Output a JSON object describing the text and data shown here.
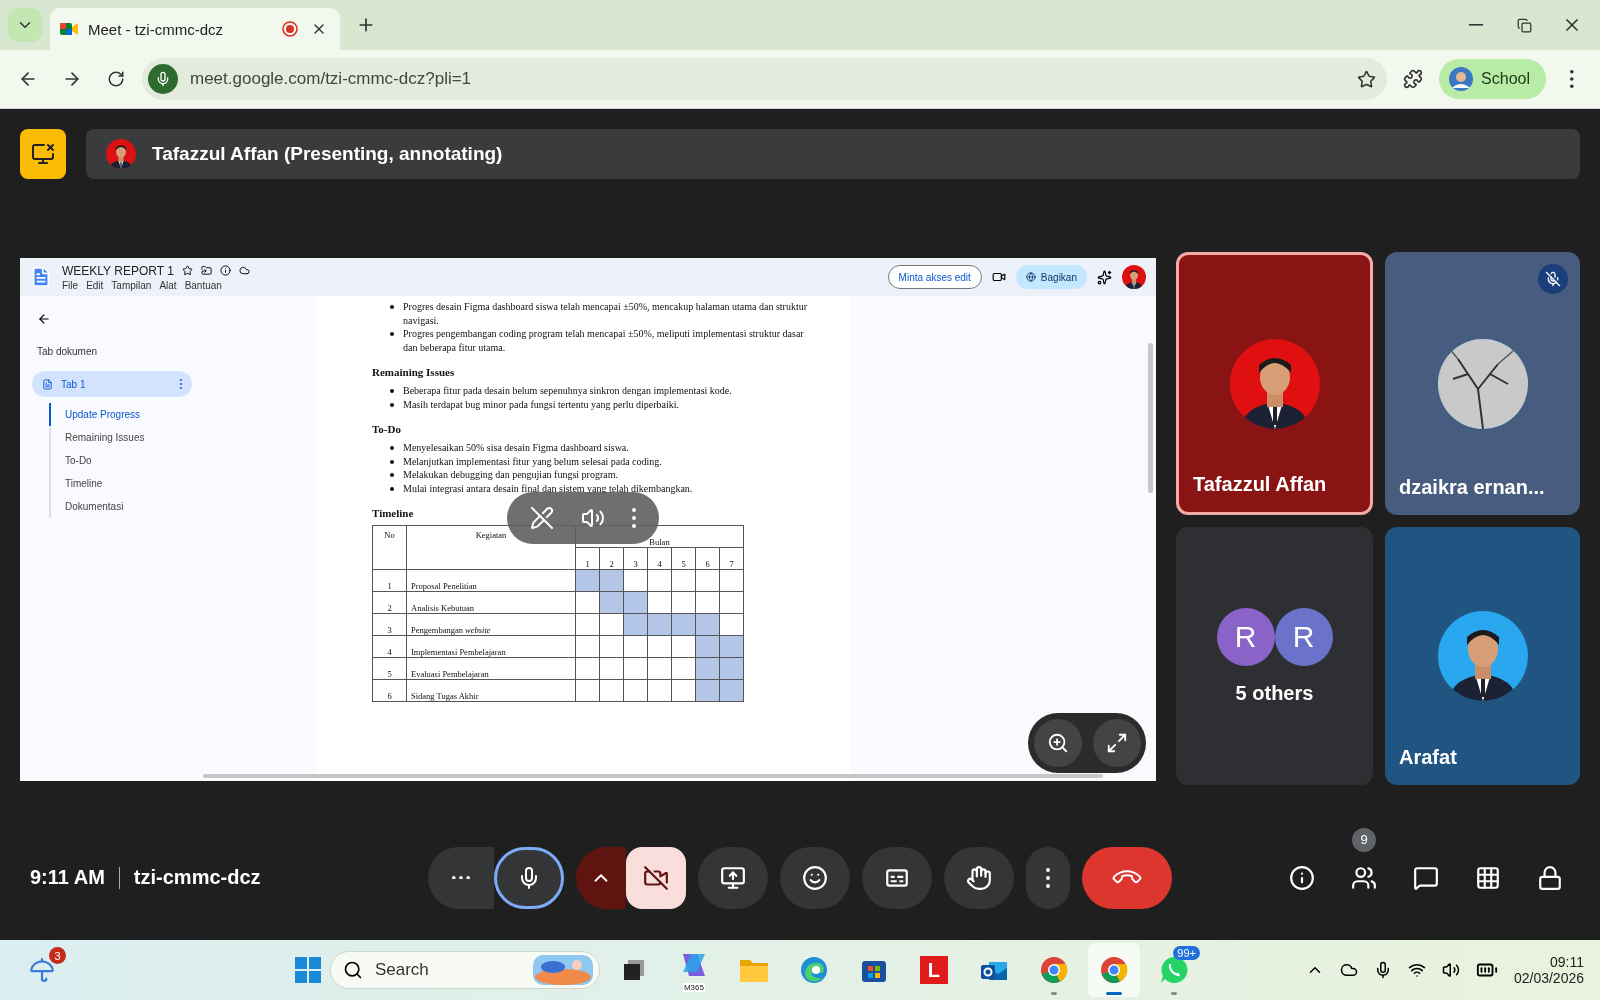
{
  "browser": {
    "tabs": [
      {
        "title": "Meet - tzi-cmmc-dcz",
        "selected": true,
        "recording": true
      }
    ],
    "url": "meet.google.com/tzi-cmmc-dcz?pli=1",
    "profile": "School"
  },
  "banner": {
    "presenter": "Tafazzul Affan (Presenting, annotating)"
  },
  "doc": {
    "title": "WEEKLY REPORT 1",
    "menus": [
      "File",
      "Edit",
      "Tampilan",
      "Alat",
      "Bantuan"
    ],
    "request_edit": "Minta akses edit",
    "share": "Bagikan",
    "sidebar": {
      "heading": "Tab dokumen",
      "tab": "Tab 1",
      "outline": [
        {
          "label": "Update Progress",
          "selected": true
        },
        {
          "label": "Remaining Issues",
          "selected": false
        },
        {
          "label": "To-Do",
          "selected": false
        },
        {
          "label": "Timeline",
          "selected": false
        },
        {
          "label": "Dokumentasi",
          "selected": false
        }
      ]
    },
    "sections": [
      {
        "bullets": [
          "Progres desain Figma dashboard siswa telah mencapai ±50%, mencakup halaman utama dan struktur navigasi.",
          "Progres pengembangan coding program telah mencapai ±50%, meliputi implementasi struktur dasar dan beberapa fitur utama."
        ]
      },
      {
        "heading": "Remaining Issues",
        "bullets": [
          "Beberapa fitur pada desain belum sepenuhnya sinkron dengan implementasi kode.",
          "Masih terdapat bug minor pada fungsi tertentu yang perlu diperbaiki."
        ]
      },
      {
        "heading": "To-Do",
        "bullets": [
          "Menyelesaikan 50% sisa desain Figma dashboard siswa.",
          "Melanjutkan implementasi fitur yang belum selesai pada coding.",
          "Melakukan debugging dan pengujian fungsi program.",
          "Mulai integrasi antara desain final dan sistem yang telah dikembangkan."
        ]
      }
    ],
    "timeline": {
      "heading": "Timeline",
      "col_no": "No",
      "col_activity": "Kegiatan",
      "col_months": "Bulan",
      "months": [
        "1",
        "2",
        "3",
        "4",
        "5",
        "6",
        "7"
      ],
      "rows": [
        {
          "no": "1",
          "activity": "Proposal Penelitian",
          "scheduled": [
            true,
            true,
            false,
            false,
            false,
            false,
            false
          ]
        },
        {
          "no": "2",
          "activity": "Analisis Kebutuan",
          "scheduled": [
            false,
            true,
            true,
            false,
            false,
            false,
            false
          ]
        },
        {
          "no": "3",
          "activity": "Pengembangan *website*",
          "scheduled": [
            false,
            false,
            true,
            true,
            true,
            true,
            false
          ]
        },
        {
          "no": "4",
          "activity": "Implementasi Pembelajaran",
          "scheduled": [
            false,
            false,
            false,
            false,
            false,
            true,
            true
          ]
        },
        {
          "no": "5",
          "activity": "Evaluasi Pembelajaran",
          "scheduled": [
            false,
            false,
            false,
            false,
            false,
            true,
            true
          ]
        },
        {
          "no": "6",
          "activity": "Sidang Tugas Akhir",
          "scheduled": [
            false,
            false,
            false,
            false,
            false,
            true,
            true
          ]
        }
      ]
    }
  },
  "participants": [
    {
      "kind": "video",
      "name": "Tafazzul Affan",
      "speaking": true,
      "muted": false,
      "color": "#8a1414"
    },
    {
      "kind": "video",
      "name": "dzaikra ernan...",
      "speaking": false,
      "muted": true,
      "color": "#475c7e"
    },
    {
      "kind": "group",
      "name": "5 others",
      "initials": [
        "R",
        "R"
      ],
      "speaking": false,
      "muted": false,
      "color": "#2e2f32"
    },
    {
      "kind": "video",
      "name": "Arafat",
      "speaking": false,
      "muted": false,
      "color": "#1f5580"
    }
  ],
  "footer": {
    "time": "9:11 AM",
    "meeting_code": "tzi-cmmc-dcz",
    "people_count": "9",
    "mic_on": true,
    "camera_on": false
  },
  "taskbar": {
    "weather_badge": "3",
    "search": {
      "placeholder": "Search"
    },
    "apps": [
      {
        "kind": "taskview",
        "running": false,
        "selected": false
      },
      {
        "kind": "copilot",
        "caption": "M365",
        "running": false,
        "selected": false
      },
      {
        "kind": "explorer",
        "running": false,
        "selected": false
      },
      {
        "kind": "edge",
        "running": false,
        "selected": false
      },
      {
        "kind": "store",
        "running": false,
        "selected": false
      },
      {
        "kind": "letter",
        "label": "L",
        "running": false,
        "selected": false
      },
      {
        "kind": "outlook",
        "running": false,
        "selected": false
      },
      {
        "kind": "chrome",
        "running": true,
        "selected": false
      },
      {
        "kind": "chrome",
        "running": true,
        "selected": true
      },
      {
        "kind": "whatsapp",
        "badge": "99+",
        "running": true,
        "selected": false
      }
    ],
    "time": "09:11",
    "date": "02/03/2026"
  }
}
